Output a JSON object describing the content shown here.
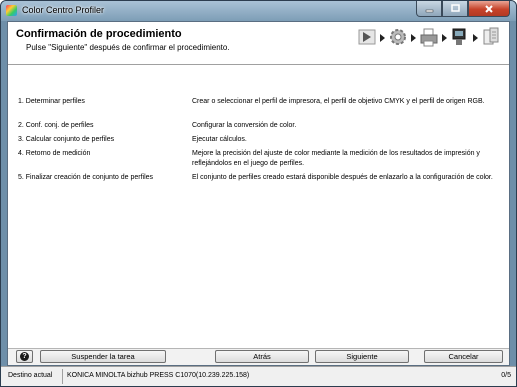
{
  "window": {
    "title": "Color Centro Profiler"
  },
  "header": {
    "title": "Confirmación de procedimiento",
    "subtitle": "Pulse \"Siguiente\" después de confirmar el procedimiento.",
    "step_icons": [
      "play-icon",
      "gear-icon",
      "printer-icon",
      "measurement-icon",
      "color-set-icon"
    ]
  },
  "procedure": [
    {
      "name": "1. Determinar perfiles",
      "description": "Crear o seleccionar el perfil de impresora, el perfil de objetivo CMYK y el perfil de origen RGB."
    },
    {
      "name": "2. Conf. conj. de perfiles",
      "description": "Configurar la conversión de color."
    },
    {
      "name": "3. Calcular conjunto de perfiles",
      "description": "Ejecutar cálculos."
    },
    {
      "name": "4. Retorno de medición",
      "description": "Mejore la precisión del ajuste de color mediante la medición de los resultados de impresión y reflejándolos en el juego de perfiles."
    },
    {
      "name": "5. Finalizar creación de conjunto de perfiles",
      "description": "El conjunto de perfiles creado estará disponible después de enlazarlo a la configuración de color."
    }
  ],
  "buttons": {
    "help": "?",
    "suspend": "Suspender la tarea",
    "back": "Atrás",
    "next": "Siguiente",
    "cancel": "Cancelar"
  },
  "status": {
    "label": "Destino actual",
    "value": "KONICA MINOLTA bizhub PRESS C1070(10.239.225.158)",
    "count": "0/5"
  }
}
